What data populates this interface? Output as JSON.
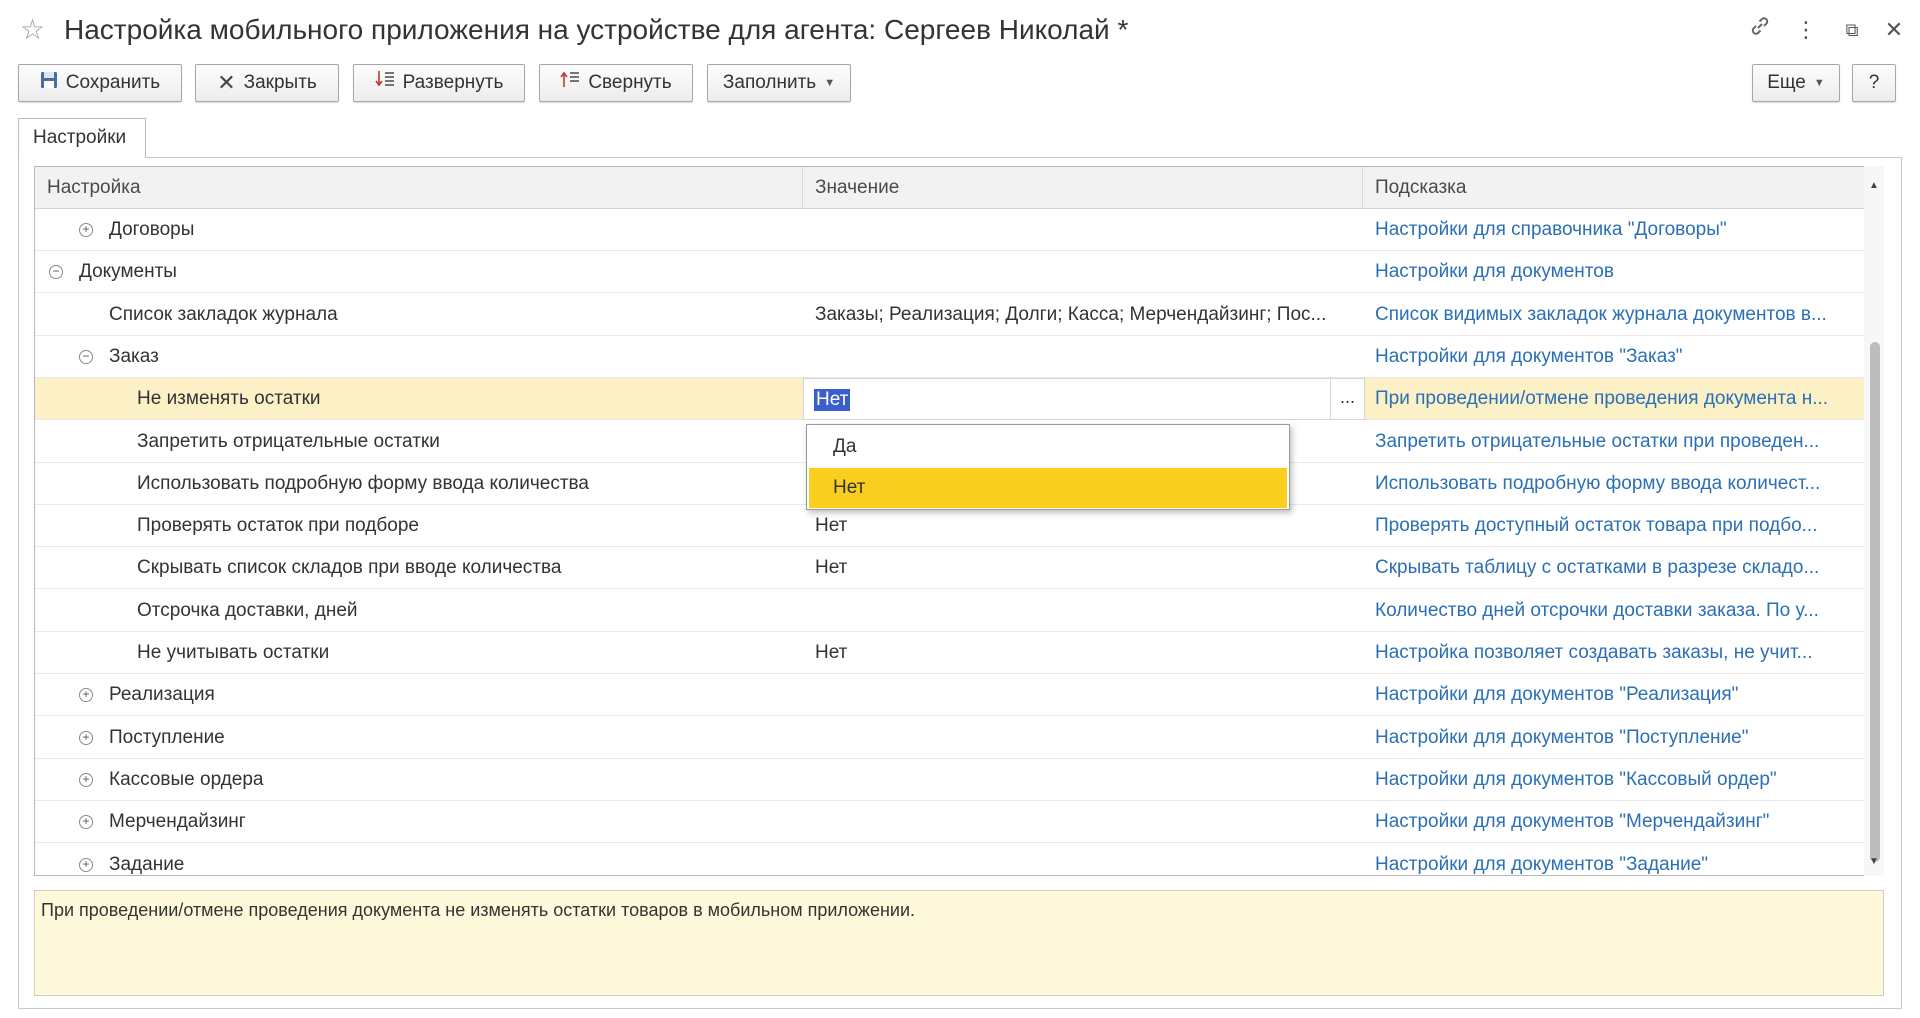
{
  "window": {
    "title": "Настройка мобильного приложения на устройстве для агента: Сергеев Николай *"
  },
  "toolbar": {
    "save_label": "Сохранить",
    "close_label": "Закрыть",
    "expand_label": "Развернуть",
    "collapse_label": "Свернуть",
    "fill_label": "Заполнить",
    "more_label": "Еще",
    "help_label": "?"
  },
  "tabs": [
    {
      "label": "Настройки"
    }
  ],
  "grid": {
    "columns": [
      "Настройка",
      "Значение",
      "Подсказка"
    ],
    "rows": [
      {
        "name": "Договоры",
        "value": "",
        "hint": "Настройки для справочника \"Договоры\"",
        "toggle": "+",
        "level": 1
      },
      {
        "name": "Документы",
        "value": "",
        "hint": "Настройки для документов",
        "toggle": "−",
        "level": 0
      },
      {
        "name": "Список закладок журнала",
        "value": "Заказы; Реализация; Долги; Касса; Мерчендайзинг; Пос...",
        "hint": "Список видимых закладок журнала документов в...",
        "toggle": "",
        "level": 1
      },
      {
        "name": "Заказ",
        "value": "",
        "hint": "Настройки для документов \"Заказ\"",
        "toggle": "−",
        "level": 1
      },
      {
        "name": "Не изменять остатки",
        "value": "Нет",
        "hint": "При проведении/отмене проведения документа н...",
        "toggle": "",
        "level": 2,
        "selected": true
      },
      {
        "name": "Запретить отрицательные остатки",
        "value": "",
        "hint": "Запретить отрицательные остатки при проведен...",
        "toggle": "",
        "level": 2
      },
      {
        "name": "Использовать подробную форму ввода количества",
        "value": "",
        "hint": "Использовать подробную форму ввода количест...",
        "toggle": "",
        "level": 2
      },
      {
        "name": "Проверять остаток при подборе",
        "value": "Нет",
        "hint": "Проверять доступный остаток товара при подбо...",
        "toggle": "",
        "level": 2
      },
      {
        "name": "Скрывать список складов при вводе количества",
        "value": "Нет",
        "hint": "Скрывать таблицу с остатками в разрезе складо...",
        "toggle": "",
        "level": 2
      },
      {
        "name": "Отсрочка доставки, дней",
        "value": "",
        "hint": "Количество дней отсрочки доставки заказа. По у...",
        "toggle": "",
        "level": 2
      },
      {
        "name": "Не учитывать остатки",
        "value": "Нет",
        "hint": "Настройка позволяет создавать заказы, не учит...",
        "toggle": "",
        "level": 2
      },
      {
        "name": "Реализация",
        "value": "",
        "hint": "Настройки для документов \"Реализация\"",
        "toggle": "+",
        "level": 1
      },
      {
        "name": "Поступление",
        "value": "",
        "hint": "Настройки для документов \"Поступление\"",
        "toggle": "+",
        "level": 1
      },
      {
        "name": "Кассовые ордера",
        "value": "",
        "hint": "Настройки для документов \"Кассовый ордер\"",
        "toggle": "+",
        "level": 1
      },
      {
        "name": "Мерчендайзинг",
        "value": "",
        "hint": "Настройки для документов \"Мерчендайзинг\"",
        "toggle": "+",
        "level": 1
      },
      {
        "name": "Задание",
        "value": "",
        "hint": "Настройки для документов \"Задание\"",
        "toggle": "+",
        "level": 1
      }
    ]
  },
  "edit": {
    "value": "Нет",
    "dots": "..."
  },
  "dropdown": {
    "options": [
      "Да",
      "Нет"
    ],
    "selected": "Нет"
  },
  "hint_text": "При проведении/отмене проведения документа не изменять остатки товаров в мобильном приложении.",
  "colors": {
    "hint_link": "#2b6fb5",
    "selected_row": "#fbf0c6",
    "dropdown_active": "#f9ce1e",
    "hint_box_bg": "#fdf9da"
  },
  "icons": {
    "favorite": "star-icon",
    "link": "link-icon",
    "menu": "kebab-menu-icon",
    "restore": "restore-window-icon",
    "close": "close-window-icon",
    "save": "floppy-disk-icon",
    "close_btn": "x-icon",
    "expand": "expand-tree-icon",
    "collapse": "collapse-tree-icon"
  }
}
